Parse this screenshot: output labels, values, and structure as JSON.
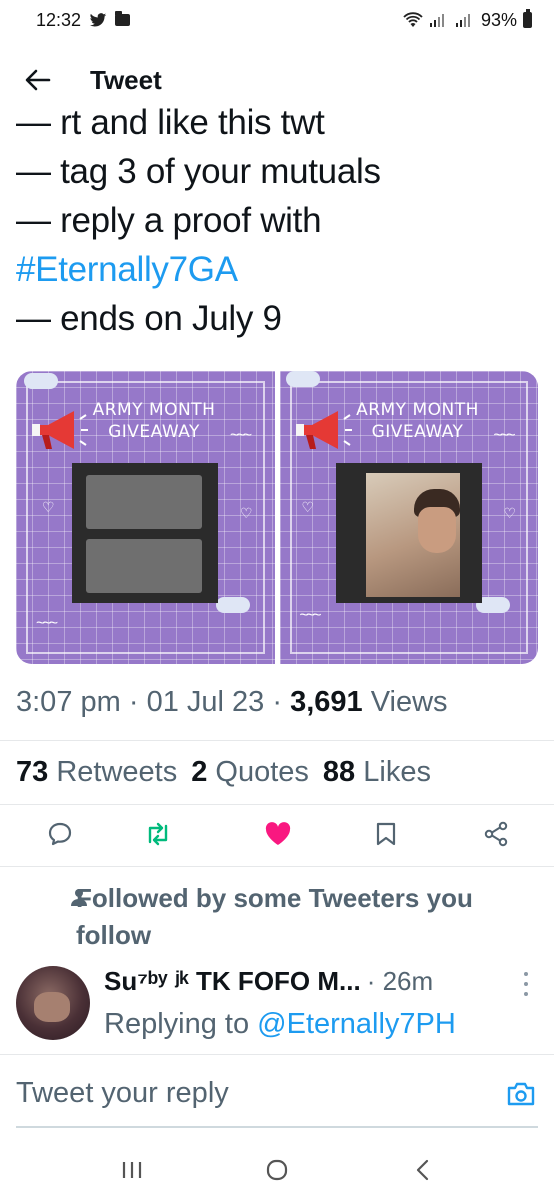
{
  "status_bar": {
    "time": "12:32",
    "battery": "93%"
  },
  "header": {
    "title": "Tweet"
  },
  "tweet": {
    "lines": [
      {
        "dash": "— ",
        "text": "rt and like this twt"
      },
      {
        "dash": "— ",
        "text": "tag 3 of your mutuals"
      },
      {
        "dash": "— ",
        "text": "reply a proof with"
      },
      {
        "dash": "",
        "text": "#Eternally7GA"
      },
      {
        "dash": "— ",
        "text": "ends on July 9"
      }
    ],
    "media": [
      {
        "title_line1": "ARMY MONTH",
        "title_line2": "GIVEAWAY"
      },
      {
        "title_line1": "ARMY MONTH",
        "title_line2": "GIVEAWAY"
      }
    ],
    "time": "3:07 pm",
    "date": "01 Jul 23",
    "views_count": "3,691",
    "views_label": "Views",
    "retweets_count": "73",
    "retweets_label": "Retweets",
    "quotes_count": "2",
    "quotes_label": "Quotes",
    "likes_count": "88",
    "likes_label": "Likes"
  },
  "actions": {
    "reply_icon": "reply-icon",
    "retweet_icon": "retweet-icon",
    "like_icon": "heart-icon",
    "bookmark_icon": "bookmark-icon",
    "share_icon": "share-icon",
    "liked_color": "#f91880",
    "retweet_color": "#00ba7c"
  },
  "followed_by": "Followed by some Tweeters you follow",
  "reply": {
    "name": "Su⁷ᵇʸ ʲᵏ TK FOFO M...",
    "time": "· 26m",
    "replying_prefix": "Replying to ",
    "replying_to": "@Eternally7PH"
  },
  "composer": {
    "placeholder": "Tweet your reply"
  },
  "colors": {
    "accent": "#1d9bf0",
    "media_purple": "#9678c9"
  }
}
